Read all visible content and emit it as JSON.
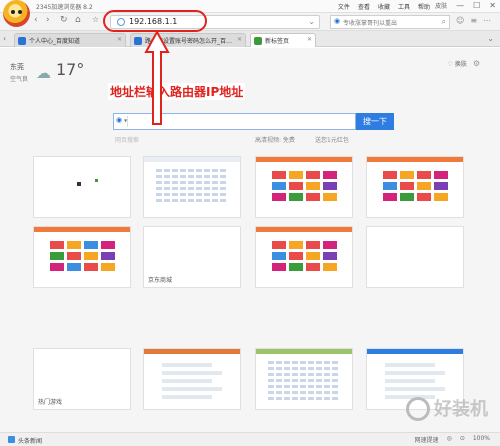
{
  "window": {
    "title": "2345加速浏览器 8.2",
    "menu": [
      "文件",
      "查看",
      "收藏",
      "工具",
      "帮助"
    ],
    "controls": [
      "皮肤",
      "—",
      "☐",
      "✕"
    ]
  },
  "toolbar": {
    "back": "‹",
    "forward": "›",
    "refresh": "↻",
    "home": "⌂",
    "address": "192.168.1.1",
    "search_placeholder": "专收涨掌哥刊以重出"
  },
  "tabs": [
    {
      "label": "个人中心_百度知道",
      "color": "#2a73d6",
      "active": false
    },
    {
      "label": "路由器设置账号密码怎么开_百…",
      "color": "#2a73d6",
      "active": false
    },
    {
      "label": "新标签页",
      "color": "#3a9b3a",
      "active": true
    }
  ],
  "weather": {
    "city": "东莞",
    "aqi": "空气良",
    "temp": "17°",
    "icon": "cloud-sun-icon"
  },
  "skin_button": "换肤",
  "search": {
    "button": "搜一下",
    "hotlinks": [
      "网页搜索",
      "高清视频: 免费",
      "送您1元红包"
    ]
  },
  "annotation": "地址栏输入路由器IP地址",
  "thumbnails": [
    {
      "label": "",
      "type": "game"
    },
    {
      "label": "",
      "type": "portal"
    },
    {
      "label": "",
      "type": "nav"
    },
    {
      "label": "",
      "type": "nav"
    },
    {
      "label": "",
      "type": "nav"
    },
    {
      "label": "京东商城",
      "type": "blank"
    },
    {
      "label": "",
      "type": "nav"
    },
    {
      "label": "",
      "type": "blank"
    },
    {
      "label": "热门游戏",
      "type": "blank"
    },
    {
      "label": "",
      "type": "doc"
    },
    {
      "label": "",
      "type": "portal"
    },
    {
      "label": "",
      "type": "list"
    }
  ],
  "statusbar": {
    "news": "头条新闻",
    "right": [
      "网速提速",
      "◎",
      "⊙",
      "100%"
    ]
  },
  "watermark": "好装机"
}
